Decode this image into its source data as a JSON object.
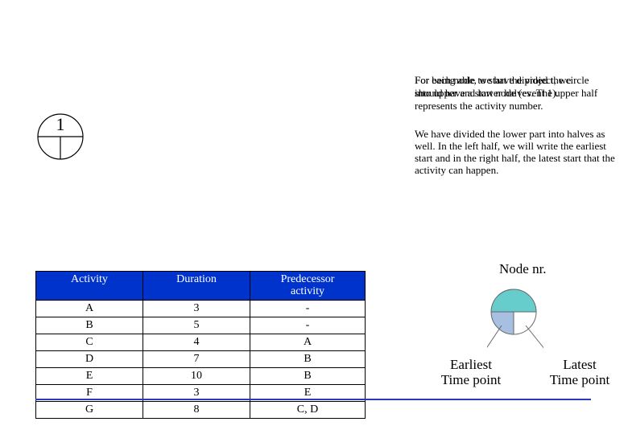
{
  "para1": {
    "overlap_a_line1": "For being able to start the project, we",
    "overlap_a_line2": "should have a start node (event 1).",
    "overlap_b_line1": "For each node, we have divided the circle",
    "overlap_b_line2": "into upper and lower halves. The upper half",
    "line3": "represents the activity number."
  },
  "para2": "We have divided the lower part into halves as well. In the left half, we will write the earliest start and in the right half, the latest start that the activity can happen.",
  "node1_label": "1",
  "table": {
    "headers": {
      "activity": "Activity",
      "duration": "Duration",
      "predecessor_line1": "Predecessor",
      "predecessor_line2": "activity"
    },
    "rows": [
      {
        "activity": "A",
        "duration": "3",
        "predecessor": "-"
      },
      {
        "activity": "B",
        "duration": "5",
        "predecessor": "-"
      },
      {
        "activity": "C",
        "duration": "4",
        "predecessor": "A"
      },
      {
        "activity": "D",
        "duration": "7",
        "predecessor": "B"
      },
      {
        "activity": "E",
        "duration": "10",
        "predecessor": "B"
      },
      {
        "activity": "F",
        "duration": "3",
        "predecessor": "E"
      },
      {
        "activity": "G",
        "duration": "8",
        "predecessor": "C, D"
      }
    ]
  },
  "legend": {
    "title": "Node nr.",
    "left_line1": "Earliest",
    "left_line2": "Time point",
    "right_line1": "Latest",
    "right_line2": "Time point"
  },
  "colors": {
    "table_header_bg": "#0033cc",
    "rule": "#2838c0",
    "legend_top_fill": "#66cccc",
    "legend_bl_fill": "#a7bfe0",
    "legend_br_fill": "#ffffff",
    "legend_stroke": "#666"
  }
}
